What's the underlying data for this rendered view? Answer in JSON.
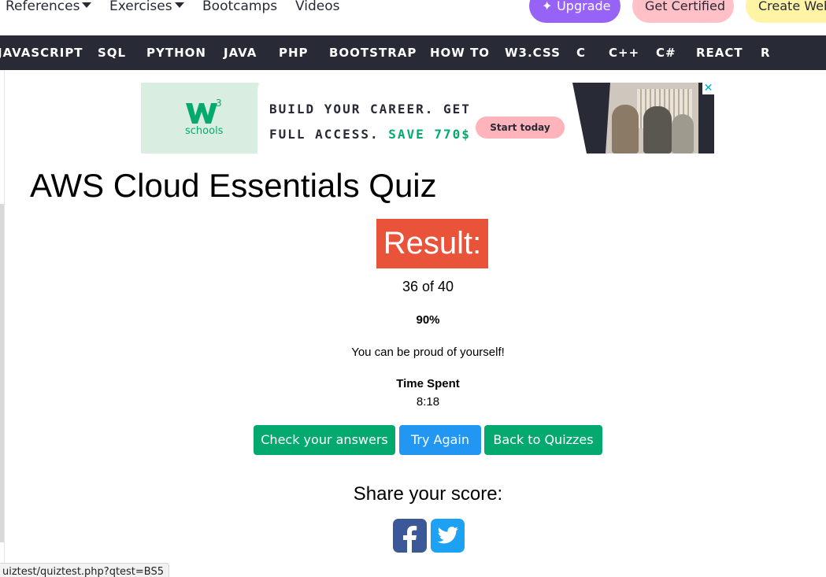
{
  "topnav": {
    "references": "References",
    "exercises": "Exercises",
    "bootcamps": "Bootcamps",
    "videos": "Videos",
    "upgrade": "Upgrade",
    "get_certified": "Get Certified",
    "create_website": "Create Web"
  },
  "subnav": [
    "JAVASCRIPT",
    "SQL",
    "PYTHON",
    "JAVA",
    "PHP",
    "BOOTSTRAP",
    "HOW TO",
    "W3.CSS",
    "C",
    "C++",
    "C#",
    "REACT",
    "R"
  ],
  "ad": {
    "logo_text": "schools",
    "line1": "BUILD YOUR CAREER. GET",
    "line2_prefix": "FULL ACCESS. ",
    "line2_accent": "SAVE 770$",
    "cta": "Start today",
    "close": "✕"
  },
  "quiz": {
    "title": "AWS Cloud Essentials Quiz",
    "result_label": "Result:",
    "score": "36 of 40",
    "percent": "90%",
    "message": "You can be proud of yourself!",
    "time_label": "Time Spent",
    "time_value": "8:18",
    "buttons": {
      "check": "Check your answers",
      "again": "Try Again",
      "back": "Back to Quizzes"
    },
    "share_label": "Share your score:"
  },
  "status_url": "uiztest/quiztest.php?qtest=BS5",
  "colors": {
    "nav_dark": "#282a35",
    "green": "#04aa6d",
    "blue": "#2196f3",
    "result_red": "#e8533a",
    "upgrade_purple": "#9763f6",
    "certified_pink": "#ffc0c7",
    "create_yellow": "#fff4a3",
    "facebook": "#3b5998",
    "twitter": "#1da1f2"
  }
}
